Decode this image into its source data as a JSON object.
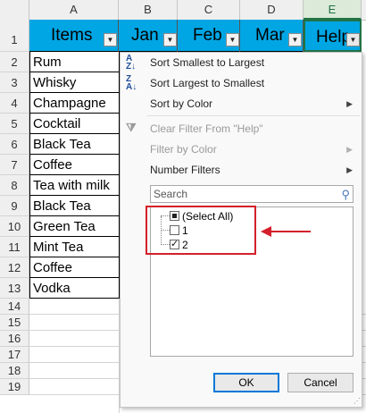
{
  "columns": [
    "A",
    "B",
    "C",
    "D",
    "E"
  ],
  "selected_column": "E",
  "rows": [
    "1",
    "2",
    "3",
    "4",
    "5",
    "6",
    "7",
    "8",
    "9",
    "10",
    "11",
    "12",
    "13",
    "14",
    "15",
    "16",
    "17",
    "18",
    "19"
  ],
  "headers": {
    "items": "Items",
    "jan": "Jan",
    "feb": "Feb",
    "mar": "Mar",
    "help": "Help"
  },
  "items": [
    "Rum",
    "Whisky",
    "Champagne",
    "Cocktail",
    "Black Tea",
    "Coffee",
    "Tea with milk",
    "Black Tea",
    "Green Tea",
    "Mint Tea",
    "Coffee",
    "Vodka"
  ],
  "menu": {
    "sort_asc": "Sort Smallest to Largest",
    "sort_desc": "Sort Largest to Smallest",
    "sort_color": "Sort by Color",
    "clear_filter": "Clear Filter From \"Help\"",
    "filter_color": "Filter by Color",
    "number_filters": "Number Filters",
    "search_placeholder": "Search",
    "list": [
      {
        "label": "(Select All)",
        "state": "partial"
      },
      {
        "label": "1",
        "state": "unchecked"
      },
      {
        "label": "2",
        "state": "checked"
      }
    ],
    "ok": "OK",
    "cancel": "Cancel"
  },
  "colors": {
    "header_fill": "#00a6e4",
    "highlight": "#d4202a",
    "selected_col": "#217346"
  }
}
